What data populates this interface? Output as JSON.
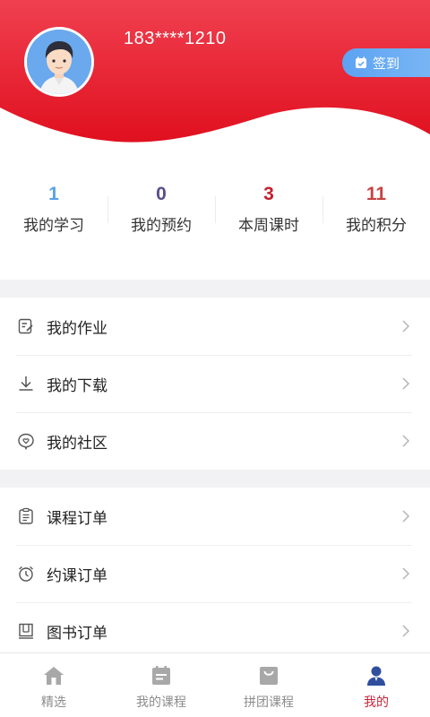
{
  "header": {
    "phone": "183****1210",
    "signin_label": "签到",
    "colors": {
      "red": "#e8202f",
      "signin": "#68aaf3"
    }
  },
  "stats": [
    {
      "value": "1",
      "label": "我的学习",
      "color": "#5aa2e6"
    },
    {
      "value": "0",
      "label": "我的预约",
      "color": "#5b4d8a"
    },
    {
      "value": "3",
      "label": "本周课时",
      "color": "#c41f2e"
    },
    {
      "value": "11",
      "label": "我的积分",
      "color": "#c74242"
    }
  ],
  "menu_group1": [
    {
      "label": "我的作业",
      "icon": "homework-icon"
    },
    {
      "label": "我的下载",
      "icon": "download-icon"
    },
    {
      "label": "我的社区",
      "icon": "community-icon"
    }
  ],
  "menu_group2": [
    {
      "label": "课程订单",
      "icon": "clipboard-icon"
    },
    {
      "label": "约课订单",
      "icon": "alarm-clock-icon"
    },
    {
      "label": "图书订单",
      "icon": "book-icon"
    }
  ],
  "tabbar": [
    {
      "label": "精选",
      "icon": "home-icon",
      "active": false
    },
    {
      "label": "我的课程",
      "icon": "course-icon",
      "active": false
    },
    {
      "label": "拼团课程",
      "icon": "bag-icon",
      "active": false
    },
    {
      "label": "我的",
      "icon": "user-icon",
      "active": true
    }
  ]
}
